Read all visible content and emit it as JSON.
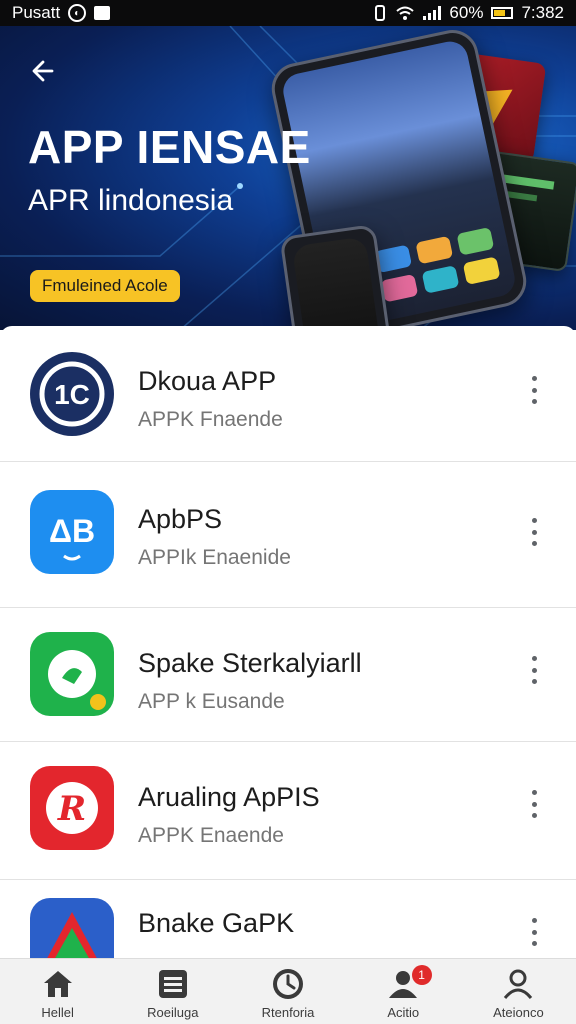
{
  "status_bar": {
    "carrier": "Pusatt",
    "battery": "60%",
    "time": "7:382"
  },
  "hero": {
    "title": "APP IENSAE",
    "subtitle": "APR lindonesia",
    "badge": "Fmuleined Acole",
    "back_icon": "arrow-left-icon"
  },
  "apps": [
    {
      "name": "Dkoua APP",
      "subtitle": "APPK Fnaende",
      "icon": "app-icon-navy",
      "color": "#1b2f63"
    },
    {
      "name": "ApbPS",
      "subtitle": "APPIk Enaenide",
      "icon": "app-icon-blue",
      "color": "#1e8ef0"
    },
    {
      "name": "Spake Sterkalyiarll",
      "subtitle": "APP k Eusande",
      "icon": "app-icon-green",
      "color": "#1fb24b"
    },
    {
      "name": "Arualing ApPIS",
      "subtitle": "APPK Enaende",
      "icon": "app-icon-red",
      "color": "#e3262d"
    },
    {
      "name": "Bnake GaPK",
      "subtitle": "",
      "icon": "app-icon-triangle",
      "color": "#2b5fc9"
    }
  ],
  "bottom_nav": {
    "items": [
      {
        "label": "Hellel",
        "icon": "home-icon"
      },
      {
        "label": "Roeiluga",
        "icon": "list-icon"
      },
      {
        "label": "Rtenforia",
        "icon": "clock-icon"
      },
      {
        "label": "Acitio",
        "icon": "notifications-icon",
        "badge": "1"
      },
      {
        "label": "Ateionco",
        "icon": "profile-icon"
      }
    ]
  },
  "colors": {
    "hero_bg": "#0f3f94",
    "badge_bg": "#f7c325",
    "notification_badge": "#e02b2b"
  }
}
